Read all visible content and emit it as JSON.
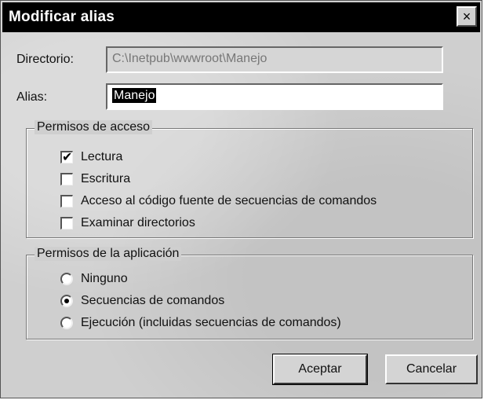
{
  "dialog": {
    "title": "Modificar alias",
    "close_glyph": "×"
  },
  "fields": {
    "directory_label": "Directorio:",
    "directory_value": "C:\\Inetpub\\wwwroot\\Manejo",
    "alias_label": "Alias:",
    "alias_value": "Manejo"
  },
  "access_permissions": {
    "title": "Permisos de acceso",
    "items": [
      {
        "label": "Lectura",
        "checked": true
      },
      {
        "label": "Escritura",
        "checked": false
      },
      {
        "label": "Acceso al código fuente de secuencias de comandos",
        "checked": false
      },
      {
        "label": "Examinar directorios",
        "checked": false
      }
    ]
  },
  "app_permissions": {
    "title": "Permisos de la aplicación",
    "items": [
      {
        "label": "Ninguno",
        "selected": false
      },
      {
        "label": "Secuencias de comandos",
        "selected": true
      },
      {
        "label": "Ejecución (incluidas secuencias de comandos)",
        "selected": false
      }
    ]
  },
  "buttons": {
    "ok_label": "Aceptar",
    "cancel_label": "Cancelar"
  }
}
